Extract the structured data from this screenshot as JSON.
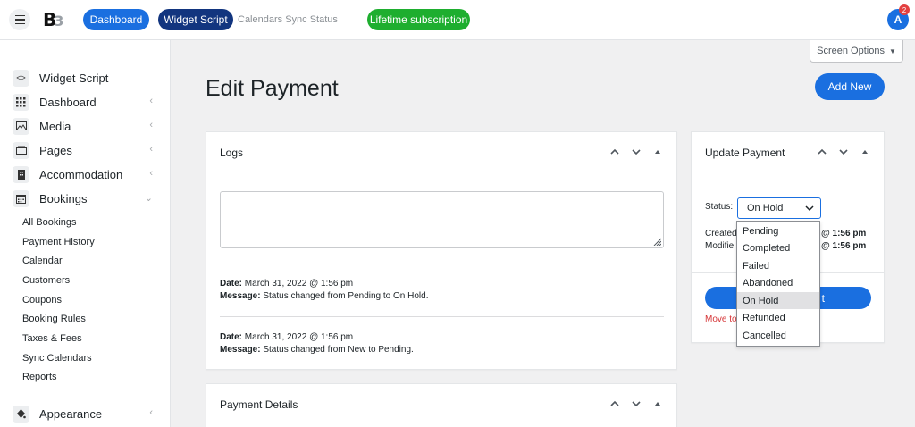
{
  "header": {
    "logo_text": "B",
    "nav": {
      "dashboard": "Dashboard",
      "widget_script": "Widget Script",
      "breadcrumb": "Calendars Sync Status",
      "lifetime": "Lifetime subscription"
    },
    "avatar_letter": "A",
    "notification_count": "2"
  },
  "sidebar": {
    "items": [
      {
        "label": "Widget Script",
        "icon": "code-icon"
      },
      {
        "label": "Dashboard",
        "icon": "grid-icon"
      },
      {
        "label": "Media",
        "icon": "image-icon"
      },
      {
        "label": "Pages",
        "icon": "pages-icon"
      },
      {
        "label": "Accommodation",
        "icon": "building-icon"
      },
      {
        "label": "Bookings",
        "icon": "calendar-icon"
      },
      {
        "label": "Appearance",
        "icon": "paint-icon"
      }
    ],
    "subitems": [
      "All Bookings",
      "Payment History",
      "Calendar",
      "Customers",
      "Coupons",
      "Booking Rules",
      "Taxes & Fees",
      "Sync Calendars",
      "Reports"
    ]
  },
  "main": {
    "screen_options": "Screen Options",
    "title": "Edit Payment",
    "add_new": "Add New",
    "logs": {
      "title": "Logs",
      "entries": [
        {
          "date_label": "Date:",
          "date": "March 31, 2022 @ 1:56 pm",
          "message_label": "Message:",
          "message": "Status changed from Pending to On Hold."
        },
        {
          "date_label": "Date:",
          "date": "March 31, 2022 @ 1:56 pm",
          "message_label": "Message:",
          "message": "Status changed from New to Pending."
        }
      ]
    },
    "payment_details": {
      "title": "Payment Details"
    },
    "update_payment": {
      "title": "Update Payment",
      "status_label": "Status:",
      "status_value": "On Hold",
      "created_label": "Created",
      "created_value": "@ 1:56 pm",
      "modified_label": "Modifie",
      "modified_value": "@ 1:56 pm",
      "update_button_partial": "t",
      "trash_partial": "Move to"
    },
    "status_options": [
      "Pending",
      "Completed",
      "Failed",
      "Abandoned",
      "On Hold",
      "Refunded",
      "Cancelled"
    ],
    "selected_option": "On Hold"
  },
  "colors": {
    "primary": "#1a6fe0",
    "dark_primary": "#12357f",
    "success": "#1eae2f",
    "danger": "#d63638"
  }
}
